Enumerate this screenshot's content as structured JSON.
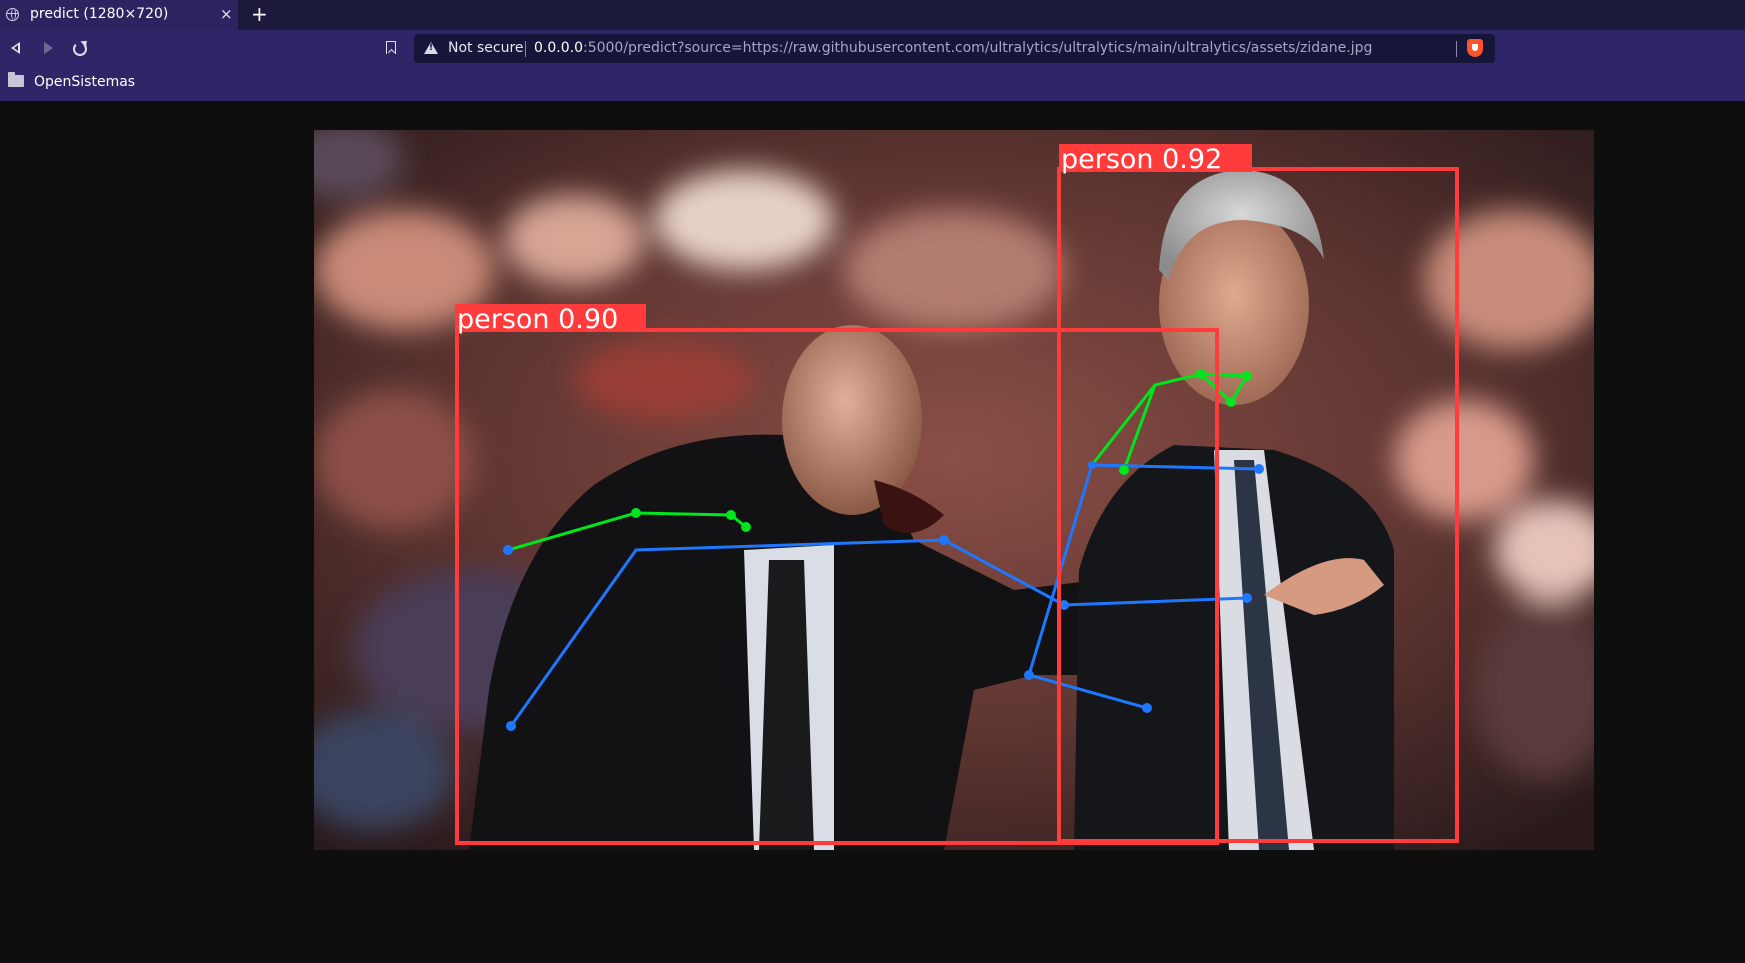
{
  "tab": {
    "title": "predict (1280×720)",
    "close_glyph": "×",
    "new_tab_glyph": "+",
    "favicon": "globe-icon"
  },
  "toolbar": {
    "back_icon": "back-icon",
    "forward_icon": "forward-icon",
    "reload_icon": "reload-icon",
    "bookmark_icon": "bookmark-icon",
    "security_label": "Not secure",
    "url_host": "0.0.0.0",
    "url_rest": ":5000/predict?source=https://raw.githubusercontent.com/ultralytics/ultralytics/main/ultralytics/assets/zidane.jpg",
    "shield_icon": "brave-shield-icon"
  },
  "bookmarks": [
    {
      "label": "OpenSistemas",
      "icon": "folder-icon"
    }
  ],
  "detections": [
    {
      "label": "person",
      "score": "0.90",
      "text": "person 0.90"
    },
    {
      "label": "person",
      "score": "0.92",
      "text": "person 0.92"
    }
  ],
  "colors": {
    "box": "#ff3b3b",
    "face_keypoints": "#00e61c",
    "body_keypoints": "#1e78ff",
    "tabbar": "#1b1a3b",
    "toolbar": "#2f2668"
  }
}
